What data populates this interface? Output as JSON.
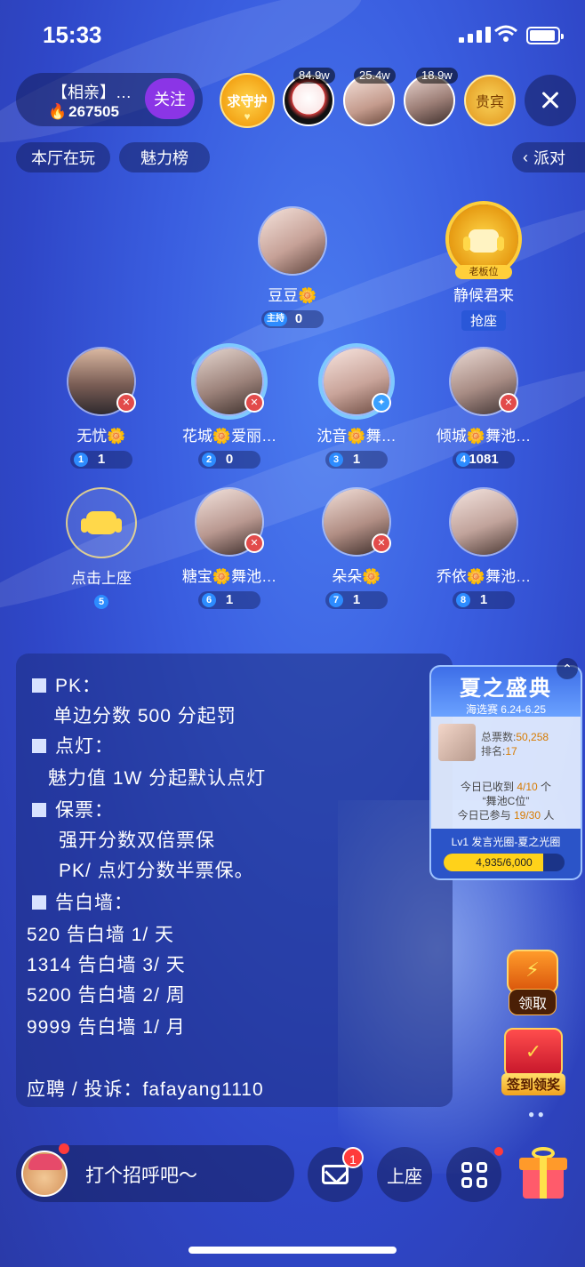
{
  "status_bar": {
    "time": "15:33"
  },
  "room": {
    "title": "【相亲】…",
    "heat": "267505",
    "follow_label": "关注",
    "guard_label": "求守护"
  },
  "top_viewers": [
    {
      "badge": "84.9w"
    },
    {
      "badge": "25.4w"
    },
    {
      "badge": "18.9w"
    }
  ],
  "vip_label": "贵宾",
  "chips": {
    "now_playing": "本厅在玩",
    "charm_rank": "魅力榜",
    "party": "派对"
  },
  "host": {
    "name": "豆豆",
    "tag": "主持",
    "score": "0"
  },
  "boss_seat": {
    "tag": "老板位",
    "name": "静候君来",
    "grab_label": "抢座"
  },
  "seats": [
    {
      "num": "1",
      "name": "无忧",
      "suffix": "",
      "score": "1"
    },
    {
      "num": "2",
      "name": "花城",
      "suffix": "爱丽…",
      "score": "0"
    },
    {
      "num": "3",
      "name": "沈音",
      "suffix": "舞…",
      "score": "1"
    },
    {
      "num": "4",
      "name": "倾城",
      "suffix": "舞池…",
      "score": "1081"
    },
    {
      "num": "5",
      "name": "点击上座",
      "suffix": "",
      "score": ""
    },
    {
      "num": "6",
      "name": "糖宝",
      "suffix": "舞池…",
      "score": "1"
    },
    {
      "num": "7",
      "name": "朵朵",
      "suffix": "",
      "score": "1"
    },
    {
      "num": "8",
      "name": "乔依",
      "suffix": "舞池…",
      "score": "1"
    }
  ],
  "notice": {
    "lines": [
      {
        "type": "head",
        "text": "PK："
      },
      {
        "type": "text",
        "text": "单边分数 500 分起罚"
      },
      {
        "type": "head",
        "text": "点灯："
      },
      {
        "type": "text",
        "text": "魅力值 1W 分起默认点灯"
      },
      {
        "type": "head",
        "text": "保票："
      },
      {
        "type": "text",
        "text": "强开分数双倍票保"
      },
      {
        "type": "text",
        "text": "PK/ 点灯分数半票保。"
      },
      {
        "type": "head",
        "text": "告白墙："
      },
      {
        "type": "plain",
        "text": "520   告白墙 1/ 天"
      },
      {
        "type": "plain",
        "text": "1314 告白墙 3/ 天"
      },
      {
        "type": "plain",
        "text": "5200 告白墙 2/ 周"
      },
      {
        "type": "plain",
        "text": "9999 告白墙 1/ 月"
      },
      {
        "type": "plain",
        "text": "应聘 / 投诉：fafayang1110"
      }
    ]
  },
  "event": {
    "title": "夏之盛典",
    "dates": "海选赛 6.24-6.25",
    "total_votes_label": "总票数:",
    "total_votes": "50,258",
    "rank_label": "排名:",
    "rank": "17",
    "received_prefix": "今日已收到",
    "received": "4/10",
    "received_suffix": "个",
    "item_name": "“舞池C位”",
    "joined_prefix": "今日已参与",
    "joined": "19/30",
    "joined_suffix": "人",
    "level_text": "Lv1 发言光圈-夏之光圈",
    "progress_text": "4,935/6,000",
    "progress_fraction": 0.8225
  },
  "side_buttons": {
    "claim": "领取",
    "signin": "签到领奖"
  },
  "bottom": {
    "chat_hint": "打个招呼吧～",
    "mail_badge": "1",
    "seat_label": "上座"
  },
  "colors": {
    "accent_purple": "#8b35e6",
    "score_blue": "#2d8cff",
    "gold": "#ffc21a"
  }
}
